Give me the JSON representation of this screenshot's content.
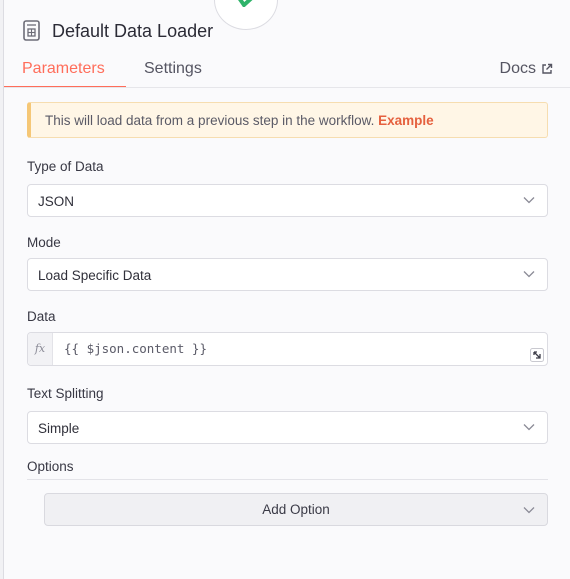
{
  "node": {
    "title": "Default Data Loader",
    "accent_color": "#2fb36a"
  },
  "tabs": [
    {
      "label": "Parameters",
      "active": true
    },
    {
      "label": "Settings",
      "active": false
    }
  ],
  "docs_label": "Docs",
  "notice": {
    "text": "This will load data from a previous step in the workflow. ",
    "link_label": "Example"
  },
  "fields": {
    "type_of_data": {
      "label": "Type of Data",
      "value": "JSON"
    },
    "mode": {
      "label": "Mode",
      "value": "Load Specific Data"
    },
    "data": {
      "label": "Data",
      "fx_label": "fx",
      "value": "{{ $json.content }}"
    },
    "text_splitting": {
      "label": "Text Splitting",
      "value": "Simple"
    }
  },
  "options": {
    "label": "Options",
    "add_button_label": "Add Option"
  },
  "colors": {
    "primary": "#ff6d5a",
    "notice_bg": "#fff6e6"
  }
}
